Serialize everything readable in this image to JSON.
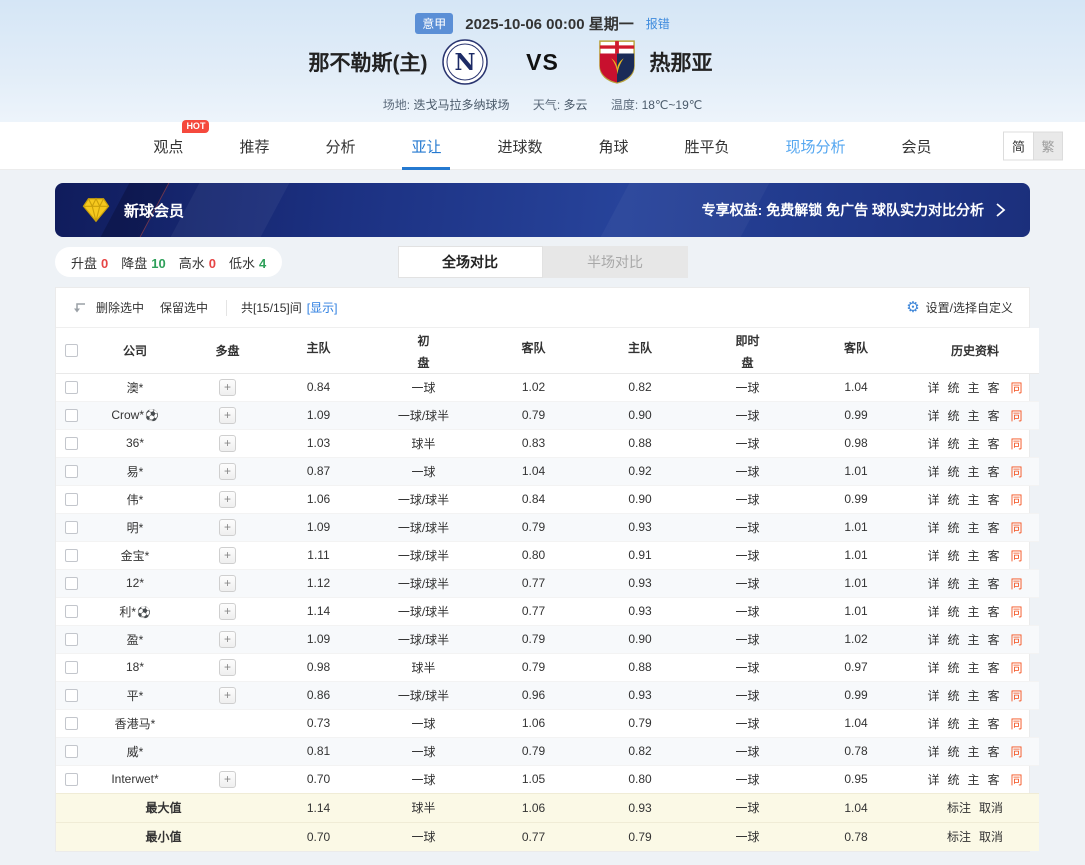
{
  "match_header": {
    "league_badge": "意甲",
    "datetime": "2025-10-06 00:00 星期一",
    "report_error": "报错",
    "home_team": "那不勒斯(主)",
    "home_logo_letter": "N",
    "vs": "VS",
    "away_team": "热那亚",
    "venue_label": "场地:",
    "venue": "迭戈马拉多纳球场",
    "weather_label": "天气:",
    "weather": "多云",
    "temp_label": "温度:",
    "temperature": "18℃~19℃"
  },
  "nav": {
    "hot_badge": "HOT",
    "tabs": [
      {
        "label": "观点",
        "hot": true
      },
      {
        "label": "推荐"
      },
      {
        "label": "分析"
      },
      {
        "label": "亚让",
        "state": "active"
      },
      {
        "label": "进球数"
      },
      {
        "label": "角球"
      },
      {
        "label": "胜平负"
      },
      {
        "label": "现场分析",
        "state": "highlight"
      },
      {
        "label": "会员"
      }
    ],
    "lang_simplified": "简",
    "lang_traditional": "繁"
  },
  "vip_banner": {
    "title": "新球会员",
    "benefits": "专享权益: 免费解锁 免广告 球队实力对比分析"
  },
  "filters": {
    "items": [
      {
        "label": "升盘",
        "value": "0",
        "color": "#e64545"
      },
      {
        "label": "降盘",
        "value": "10",
        "color": "#2fa05a"
      },
      {
        "label": "高水",
        "value": "0",
        "color": "#e64545"
      },
      {
        "label": "低水",
        "value": "4",
        "color": "#2fa05a"
      }
    ]
  },
  "scope_tabs": {
    "full": "全场对比",
    "half": "半场对比"
  },
  "table_controls": {
    "delete_selected": "删除选中",
    "keep_selected": "保留选中",
    "count_text": "共[15/15]间",
    "show_link": "[显示]",
    "gear_icon": "⚙",
    "settings": "设置/选择自定义"
  },
  "odds_table": {
    "headers": {
      "company": "公司",
      "multi": "多盘",
      "initial_line1": "初",
      "initial_line2": "盘",
      "live_line1": "即时",
      "live_line2": "盘",
      "home": "主队",
      "away": "客队",
      "history": "历史资料"
    },
    "plus_icon": "+",
    "ball_icon": "⚽",
    "history_links": [
      "详",
      "统",
      "主",
      "客"
    ],
    "same_link": "同",
    "summary_links": [
      "标注",
      "取消"
    ],
    "rows": [
      {
        "name": "澳*",
        "ball": false,
        "plus": true,
        "init_home": "0.84",
        "init_handicap": "一球",
        "init_away": "1.02",
        "live_home": "0.82",
        "live_handicap": "一球",
        "live_away": "1.04"
      },
      {
        "name": "Crow*",
        "ball": true,
        "plus": true,
        "init_home": "1.09",
        "init_handicap": "一球/球半",
        "init_away": "0.79",
        "live_home": "0.90",
        "live_handicap": "一球",
        "live_away": "0.99"
      },
      {
        "name": "36*",
        "ball": false,
        "plus": true,
        "init_home": "1.03",
        "init_handicap": "球半",
        "init_away": "0.83",
        "live_home": "0.88",
        "live_handicap": "一球",
        "live_away": "0.98"
      },
      {
        "name": "易*",
        "ball": false,
        "plus": true,
        "init_home": "0.87",
        "init_handicap": "一球",
        "init_away": "1.04",
        "live_home": "0.92",
        "live_handicap": "一球",
        "live_away": "1.01"
      },
      {
        "name": "伟*",
        "ball": false,
        "plus": true,
        "init_home": "1.06",
        "init_handicap": "一球/球半",
        "init_away": "0.84",
        "live_home": "0.90",
        "live_handicap": "一球",
        "live_away": "0.99"
      },
      {
        "name": "明*",
        "ball": false,
        "plus": true,
        "init_home": "1.09",
        "init_handicap": "一球/球半",
        "init_away": "0.79",
        "live_home": "0.93",
        "live_handicap": "一球",
        "live_away": "1.01"
      },
      {
        "name": "金宝*",
        "ball": false,
        "plus": true,
        "init_home": "1.11",
        "init_handicap": "一球/球半",
        "init_away": "0.80",
        "live_home": "0.91",
        "live_handicap": "一球",
        "live_away": "1.01"
      },
      {
        "name": "12*",
        "ball": false,
        "plus": true,
        "init_home": "1.12",
        "init_handicap": "一球/球半",
        "init_away": "0.77",
        "live_home": "0.93",
        "live_handicap": "一球",
        "live_away": "1.01"
      },
      {
        "name": "利*",
        "ball": true,
        "plus": true,
        "init_home": "1.14",
        "init_handicap": "一球/球半",
        "init_away": "0.77",
        "live_home": "0.93",
        "live_handicap": "一球",
        "live_away": "1.01"
      },
      {
        "name": "盈*",
        "ball": false,
        "plus": true,
        "init_home": "1.09",
        "init_handicap": "一球/球半",
        "init_away": "0.79",
        "live_home": "0.90",
        "live_handicap": "一球",
        "live_away": "1.02"
      },
      {
        "name": "18*",
        "ball": false,
        "plus": true,
        "init_home": "0.98",
        "init_handicap": "球半",
        "init_away": "0.79",
        "live_home": "0.88",
        "live_handicap": "一球",
        "live_away": "0.97"
      },
      {
        "name": "平*",
        "ball": false,
        "plus": true,
        "init_home": "0.86",
        "init_handicap": "一球/球半",
        "init_away": "0.96",
        "live_home": "0.93",
        "live_handicap": "一球",
        "live_away": "0.99"
      },
      {
        "name": "香港马*",
        "ball": false,
        "plus": false,
        "init_home": "0.73",
        "init_handicap": "一球",
        "init_away": "1.06",
        "live_home": "0.79",
        "live_handicap": "一球",
        "live_away": "1.04"
      },
      {
        "name": "威*",
        "ball": false,
        "plus": false,
        "init_home": "0.81",
        "init_handicap": "一球",
        "init_away": "0.79",
        "live_home": "0.82",
        "live_handicap": "一球",
        "live_away": "0.78"
      },
      {
        "name": "Interwet*",
        "ball": false,
        "plus": true,
        "init_home": "0.70",
        "init_handicap": "一球",
        "init_away": "1.05",
        "live_home": "0.80",
        "live_handicap": "一球",
        "live_away": "0.95"
      }
    ],
    "summary": [
      {
        "label": "最大值",
        "init_home": "1.14",
        "init_handicap": "球半",
        "init_away": "1.06",
        "live_home": "0.93",
        "live_handicap": "一球",
        "live_away": "1.04"
      },
      {
        "label": "最小值",
        "init_home": "0.70",
        "init_handicap": "一球",
        "init_away": "0.77",
        "live_home": "0.79",
        "live_handicap": "一球",
        "live_away": "0.78"
      }
    ]
  },
  "colors": {
    "accent_blue": "#2479d0",
    "link_blue": "#3d8add",
    "hot_red": "#f5493d",
    "rise_red": "#e64545",
    "drop_green": "#2fa05a",
    "same_orange": "#f4511e",
    "banner_navy": "#1c3182",
    "header_bg": "#d5e6f6",
    "summary_bg": "#fbf9e6"
  }
}
